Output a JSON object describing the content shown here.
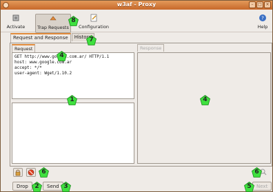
{
  "window": {
    "title": "w3af - Proxy",
    "close_glyph": "×",
    "min_glyph": "–",
    "max_glyph": "□"
  },
  "toolbar": {
    "activate_label": "Activate",
    "trap_label": "Trap Requests",
    "config_label": "Configuration",
    "help_label": "Help"
  },
  "tabs": [
    {
      "label": "Request and Response"
    },
    {
      "label": "History"
    }
  ],
  "request_panel": {
    "tab_label": "Request",
    "text": "GET http://www.google.com.ar/ HTTP/1.1\nhost: www.google.com.ar\naccept: */*\nuser-agent: Wget/1.10.2"
  },
  "response_panel": {
    "tab_label": "Response"
  },
  "buttons": {
    "drop_label": "Drop",
    "send_label": "Send",
    "next_label": "Next"
  },
  "badges": [
    "8",
    "7",
    "4",
    "1",
    "4",
    "6",
    "6",
    "2",
    "3",
    "5"
  ],
  "colors": {
    "badge_fill": "#3fe03f",
    "accent": "#e08a3a",
    "title_bar": "#d67a3a"
  }
}
